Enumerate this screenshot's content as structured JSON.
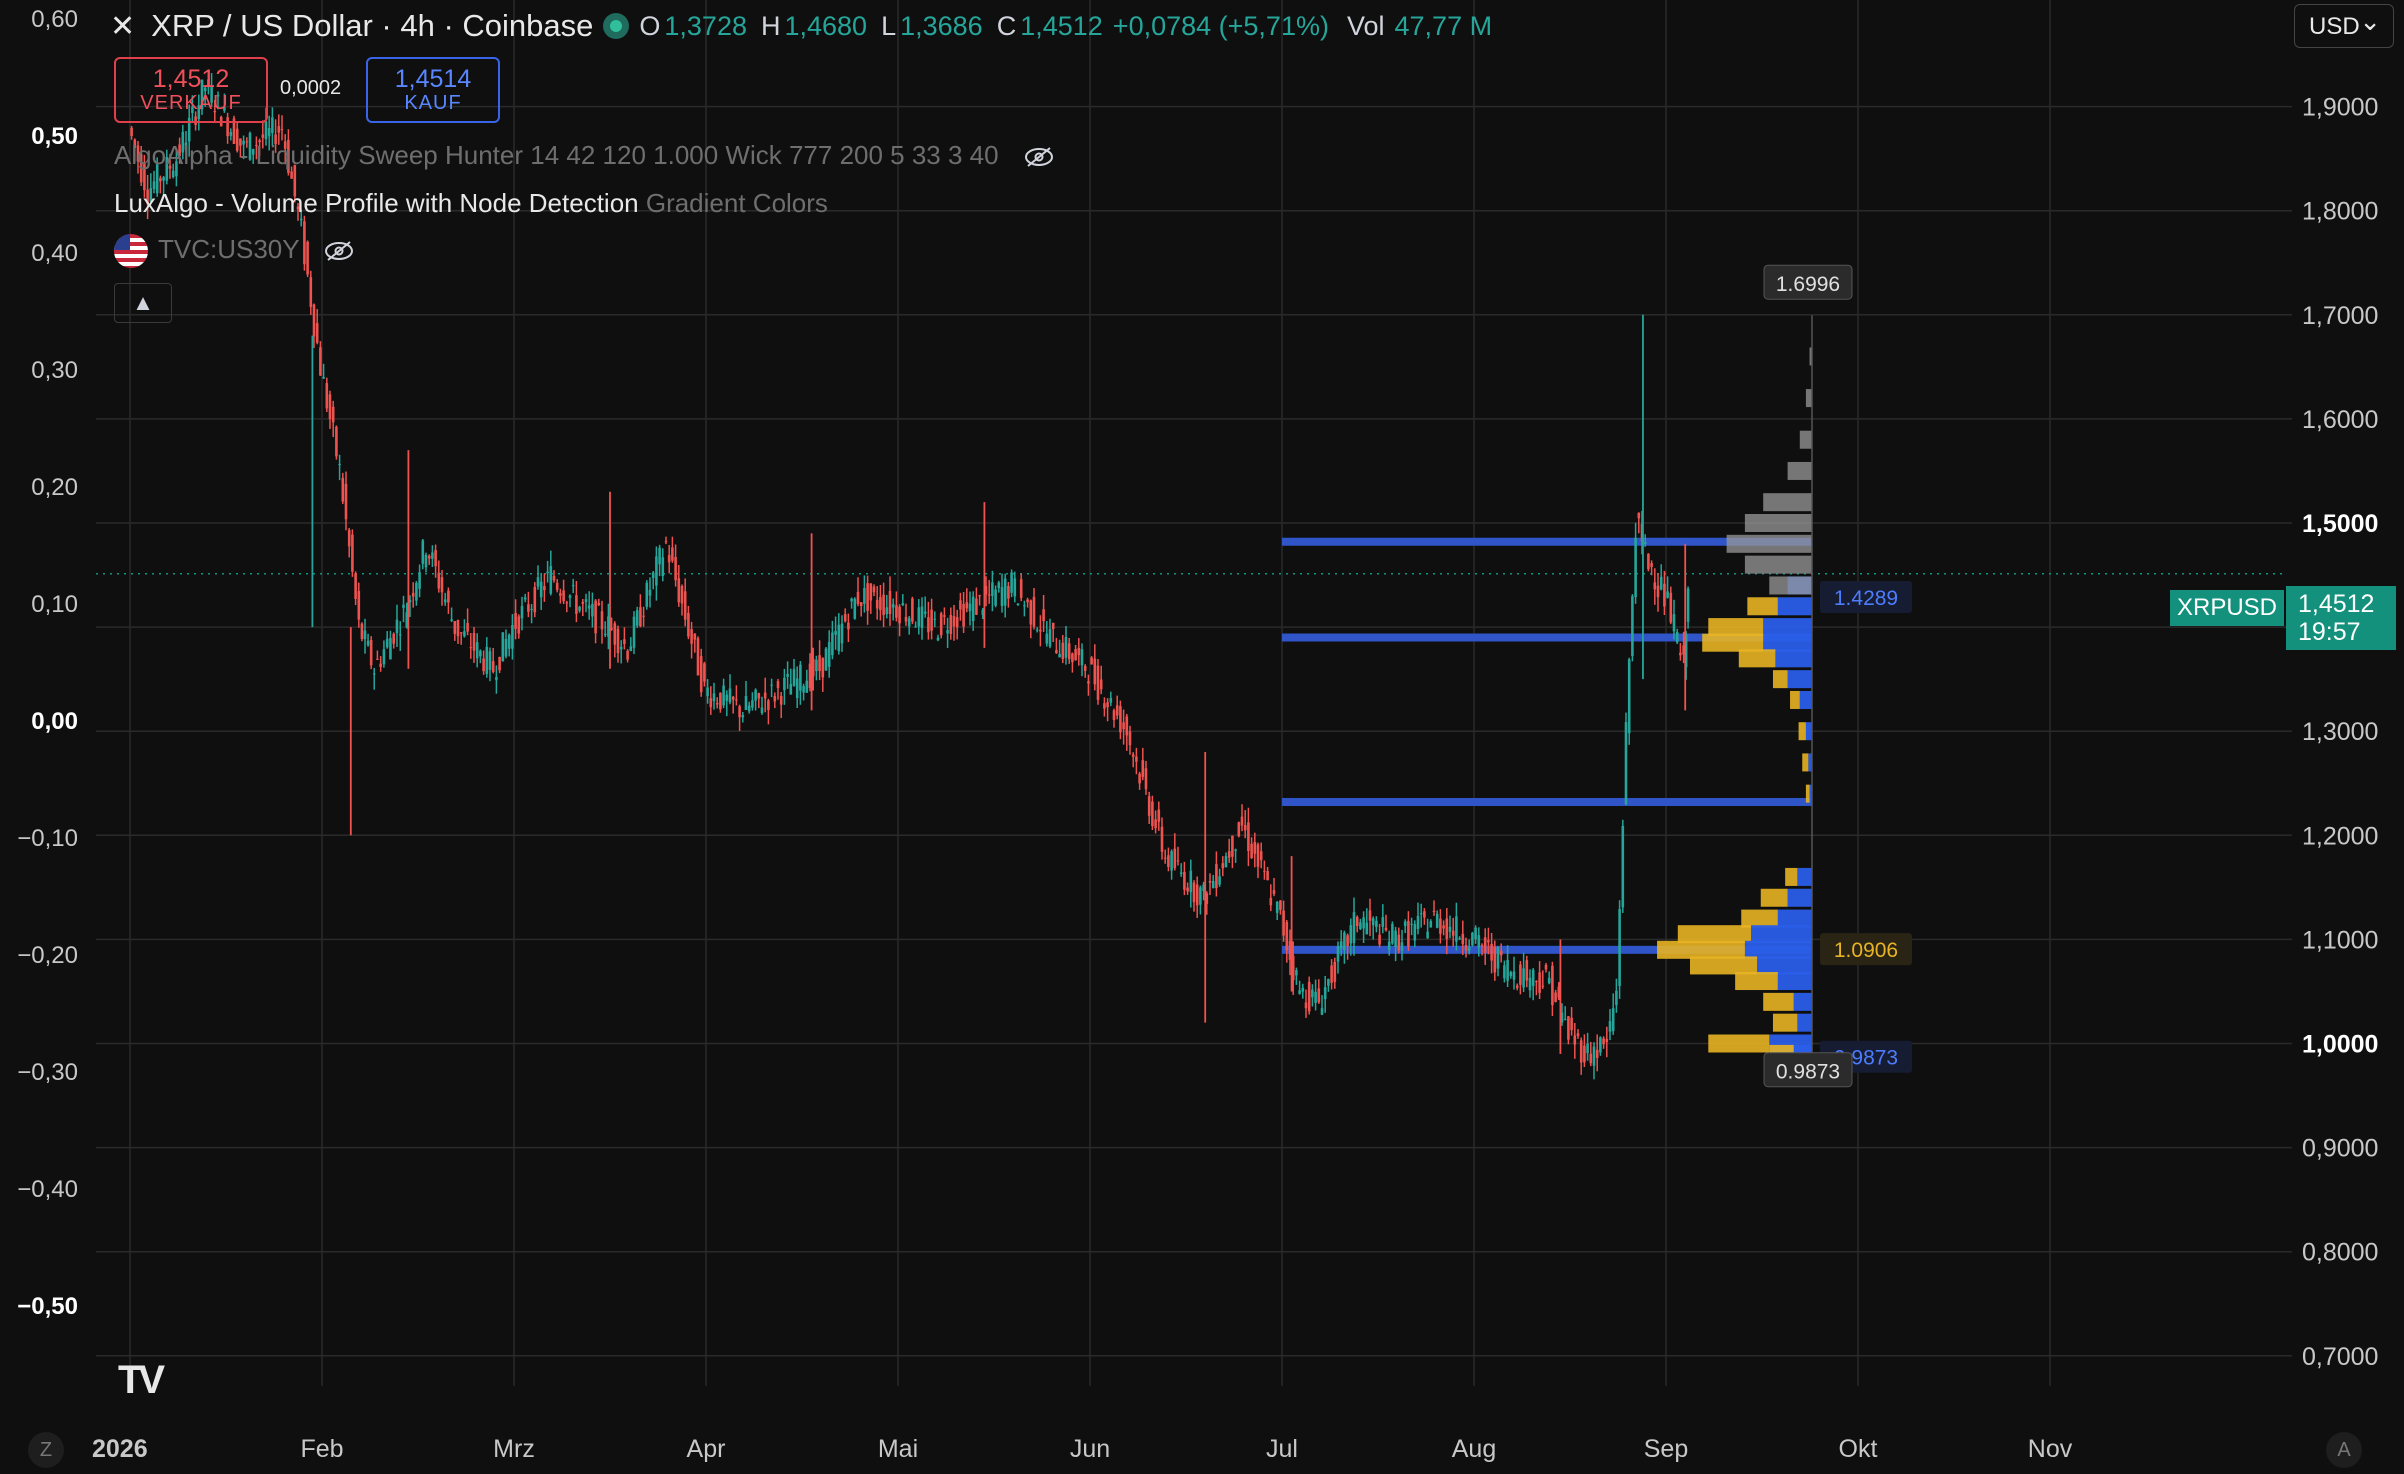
{
  "header": {
    "title": "XRP / US Dollar · 4h · Coinbase",
    "ohlc": [
      {
        "k": "O",
        "v": "1,3728"
      },
      {
        "k": "H",
        "v": "1,4680"
      },
      {
        "k": "L",
        "v": "1,3686"
      },
      {
        "k": "C",
        "v": "1,4512"
      }
    ],
    "change": "+0,0784 (+5,71%)",
    "vol_label": "Vol",
    "vol_value": "47,77 M"
  },
  "trade": {
    "sell_price": "1,4512",
    "sell_label": "VERKAUF",
    "spread": "0,0002",
    "buy_price": "1,4514",
    "buy_label": "KAUF"
  },
  "indicators": {
    "ind1": "AlgoAlpha - Liquidity Sweep Hunter 14 42 120 1.000 Wick 777 200 5 33 3 40",
    "ind2_name": "LuxAlgo - Volume Profile with Node Detection",
    "ind2_args": "Gradient Colors",
    "ind3": "TVC:US30Y",
    "collapse_icon": "▲"
  },
  "currency": "USD",
  "last_price": {
    "symbol": "XRPUSD",
    "price": "1,4512",
    "countdown": "19:57"
  },
  "colors": {
    "up": "#26a69a",
    "down": "#ef5350",
    "bg": "#0f0f0f",
    "grid": "#2a2a2a",
    "node_blue": "#2f55c8",
    "profile_yellow": "#e8b423",
    "profile_blue": "#2a5ee8",
    "profile_grey": "#9a9a9a"
  },
  "chart_data": {
    "type": "candlestick",
    "title": "XRP / US Dollar · 4h · Coinbase",
    "x_ticks": [
      "2026",
      "Feb",
      "Mrz",
      "Apr",
      "Mai",
      "Jun",
      "Jul",
      "Aug",
      "Sep",
      "Okt",
      "Nov"
    ],
    "right_axis": {
      "ylim": [
        0.68,
        2.0
      ],
      "ticks": [
        "1,9000",
        "1,8000",
        "1,7000",
        "1,6000",
        "1,5000",
        "1,4000",
        "1,3000",
        "1,2000",
        "1,1000",
        "1,0000",
        "0,9000",
        "0,8000",
        "0,7000"
      ],
      "bold_ticks": [
        "1,5000",
        "1,0000"
      ]
    },
    "left_axis": {
      "label": "TVC:US30Y",
      "ticks": [
        "0,60",
        "0,50",
        "0,40",
        "0,30",
        "0,20",
        "0,10",
        "0,00",
        "−0,10",
        "−0,20",
        "−0,30",
        "−0,40",
        "−0,50"
      ],
      "bold_ticks": [
        "0,50",
        "0,00",
        "−0,50"
      ]
    },
    "price_path": [
      [
        0.0,
        1.88
      ],
      [
        0.1,
        1.82
      ],
      [
        0.25,
        1.85
      ],
      [
        0.4,
        1.92
      ],
      [
        0.6,
        1.86
      ],
      [
        0.8,
        1.88
      ],
      [
        0.9,
        1.78
      ],
      [
        1.0,
        1.65
      ],
      [
        1.1,
        1.55
      ],
      [
        1.2,
        1.4
      ],
      [
        1.28,
        1.36
      ],
      [
        1.45,
        1.42
      ],
      [
        1.55,
        1.48
      ],
      [
        1.7,
        1.4
      ],
      [
        1.9,
        1.36
      ],
      [
        2.0,
        1.4
      ],
      [
        2.2,
        1.45
      ],
      [
        2.35,
        1.42
      ],
      [
        2.5,
        1.4
      ],
      [
        2.6,
        1.38
      ],
      [
        2.7,
        1.43
      ],
      [
        2.8,
        1.48
      ],
      [
        3.0,
        1.34
      ],
      [
        3.2,
        1.32
      ],
      [
        3.4,
        1.34
      ],
      [
        3.6,
        1.36
      ],
      [
        3.8,
        1.43
      ],
      [
        4.0,
        1.42
      ],
      [
        4.2,
        1.4
      ],
      [
        4.4,
        1.42
      ],
      [
        4.6,
        1.44
      ],
      [
        4.8,
        1.39
      ],
      [
        5.0,
        1.36
      ],
      [
        5.2,
        1.3
      ],
      [
        5.4,
        1.18
      ],
      [
        5.6,
        1.14
      ],
      [
        5.8,
        1.21
      ],
      [
        6.0,
        1.12
      ],
      [
        6.1,
        1.05
      ],
      [
        6.2,
        1.04
      ],
      [
        6.4,
        1.12
      ],
      [
        6.6,
        1.1
      ],
      [
        6.8,
        1.12
      ],
      [
        7.0,
        1.1
      ],
      [
        7.2,
        1.07
      ],
      [
        7.4,
        1.06
      ],
      [
        7.5,
        1.01
      ],
      [
        7.6,
        0.99
      ],
      [
        7.7,
        1.0
      ],
      [
        7.75,
        1.05
      ],
      [
        7.8,
        1.3
      ],
      [
        7.85,
        1.5
      ],
      [
        7.9,
        1.47
      ],
      [
        8.0,
        1.43
      ],
      [
        8.05,
        1.4
      ],
      [
        8.1,
        1.36
      ],
      [
        8.12,
        1.45
      ]
    ],
    "wicks": [
      {
        "x": 0.95,
        "low": 1.4,
        "high": 1.68
      },
      {
        "x": 1.15,
        "low": 1.2,
        "high": 1.4
      },
      {
        "x": 1.45,
        "low": 1.36,
        "high": 1.57
      },
      {
        "x": 2.5,
        "low": 1.36,
        "high": 1.53
      },
      {
        "x": 3.55,
        "low": 1.32,
        "high": 1.49
      },
      {
        "x": 4.45,
        "low": 1.38,
        "high": 1.52
      },
      {
        "x": 5.6,
        "low": 1.02,
        "high": 1.28
      },
      {
        "x": 6.05,
        "low": 1.05,
        "high": 1.18
      },
      {
        "x": 7.45,
        "low": 0.99,
        "high": 1.1
      },
      {
        "x": 7.88,
        "low": 1.35,
        "high": 1.7
      },
      {
        "x": 8.1,
        "low": 1.32,
        "high": 1.48
      }
    ],
    "node_lines": [
      {
        "x_start": 6.0,
        "price": 1.482
      },
      {
        "x_start": 6.0,
        "price": 1.39
      },
      {
        "x_start": 6.0,
        "price": 1.232
      },
      {
        "x_start": 6.0,
        "price": 1.09
      }
    ],
    "profile_labels": [
      {
        "text": "1.6996",
        "price": 1.6996,
        "style": "box"
      },
      {
        "text": "1.4289",
        "price": 1.4289,
        "style": "blue"
      },
      {
        "text": "1.0906",
        "price": 1.0906,
        "style": "yellow"
      },
      {
        "text": "0.9873",
        "price": 0.9873,
        "style": "blue"
      },
      {
        "text": "0.9873",
        "price": 0.9873,
        "style": "box"
      }
    ],
    "volume_profile": [
      {
        "price": 1.66,
        "grey": 2,
        "yellow": 0,
        "blue": 0
      },
      {
        "price": 1.62,
        "grey": 5,
        "yellow": 0,
        "blue": 0
      },
      {
        "price": 1.58,
        "grey": 10,
        "yellow": 0,
        "blue": 0
      },
      {
        "price": 1.55,
        "grey": 20,
        "yellow": 0,
        "blue": 0
      },
      {
        "price": 1.52,
        "grey": 40,
        "yellow": 0,
        "blue": 0
      },
      {
        "price": 1.5,
        "grey": 55,
        "yellow": 0,
        "blue": 0
      },
      {
        "price": 1.48,
        "grey": 70,
        "yellow": 0,
        "blue": 0
      },
      {
        "price": 1.46,
        "grey": 55,
        "yellow": 0,
        "blue": 0
      },
      {
        "price": 1.44,
        "grey": 35,
        "yellow": 0,
        "blue": 20
      },
      {
        "price": 1.42,
        "grey": 0,
        "yellow": 25,
        "blue": 28
      },
      {
        "price": 1.4,
        "grey": 0,
        "yellow": 45,
        "blue": 40
      },
      {
        "price": 1.385,
        "grey": 0,
        "yellow": 50,
        "blue": 40
      },
      {
        "price": 1.37,
        "grey": 0,
        "yellow": 30,
        "blue": 30
      },
      {
        "price": 1.35,
        "grey": 0,
        "yellow": 12,
        "blue": 20
      },
      {
        "price": 1.33,
        "grey": 0,
        "yellow": 8,
        "blue": 10
      },
      {
        "price": 1.3,
        "grey": 0,
        "yellow": 6,
        "blue": 5
      },
      {
        "price": 1.27,
        "grey": 0,
        "yellow": 5,
        "blue": 3
      },
      {
        "price": 1.24,
        "grey": 0,
        "yellow": 3,
        "blue": 2
      },
      {
        "price": 1.16,
        "grey": 0,
        "yellow": 10,
        "blue": 12
      },
      {
        "price": 1.14,
        "grey": 0,
        "yellow": 22,
        "blue": 20
      },
      {
        "price": 1.12,
        "grey": 0,
        "yellow": 30,
        "blue": 28
      },
      {
        "price": 1.105,
        "grey": 0,
        "yellow": 60,
        "blue": 50
      },
      {
        "price": 1.09,
        "grey": 0,
        "yellow": 72,
        "blue": 55
      },
      {
        "price": 1.075,
        "grey": 0,
        "yellow": 55,
        "blue": 45
      },
      {
        "price": 1.06,
        "grey": 0,
        "yellow": 35,
        "blue": 28
      },
      {
        "price": 1.04,
        "grey": 0,
        "yellow": 25,
        "blue": 15
      },
      {
        "price": 1.02,
        "grey": 0,
        "yellow": 20,
        "blue": 12
      },
      {
        "price": 1.0,
        "grey": 0,
        "yellow": 50,
        "blue": 35
      },
      {
        "price": 0.99,
        "grey": 0,
        "yellow": 20,
        "blue": 15
      }
    ]
  }
}
